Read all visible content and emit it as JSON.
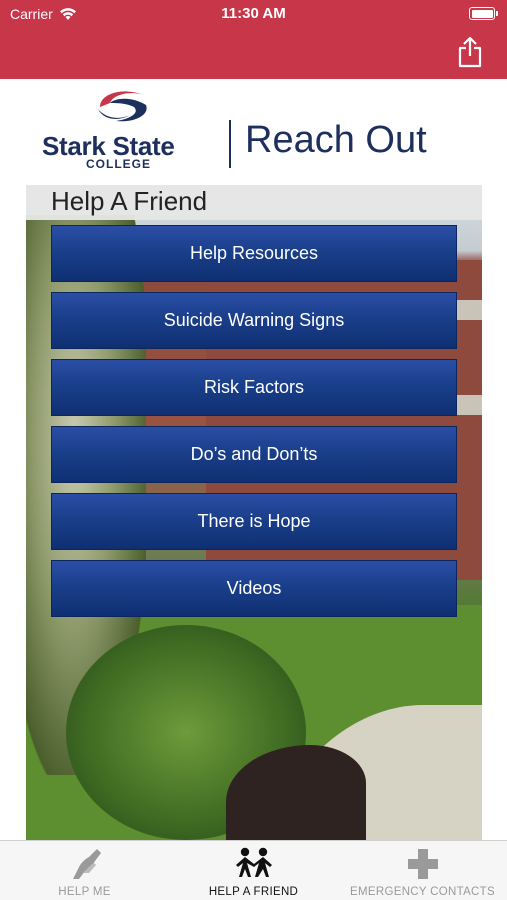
{
  "status_bar": {
    "carrier": "Carrier",
    "time": "11:30 AM"
  },
  "nav": {
    "share_icon": "share-icon",
    "bar_color": "#c8364a"
  },
  "header": {
    "logo_name": "Stark State",
    "logo_sub": "COLLEGE",
    "app_title": "Reach Out",
    "brand_color": "#1d2f5c"
  },
  "section_title": "Help A Friend",
  "menu": [
    {
      "label": "Help Resources"
    },
    {
      "label": "Suicide Warning Signs"
    },
    {
      "label": "Risk Factors"
    },
    {
      "label": "Do’s and Don’ts"
    },
    {
      "label": "There is Hope"
    },
    {
      "label": "Videos"
    }
  ],
  "tabs": [
    {
      "label": "HELP ME",
      "icon": "helping-hands-icon",
      "active": false
    },
    {
      "label": "HELP A FRIEND",
      "icon": "two-people-icon",
      "active": true
    },
    {
      "label": "EMERGENCY CONTACTS",
      "icon": "medical-cross-icon",
      "active": false
    }
  ]
}
